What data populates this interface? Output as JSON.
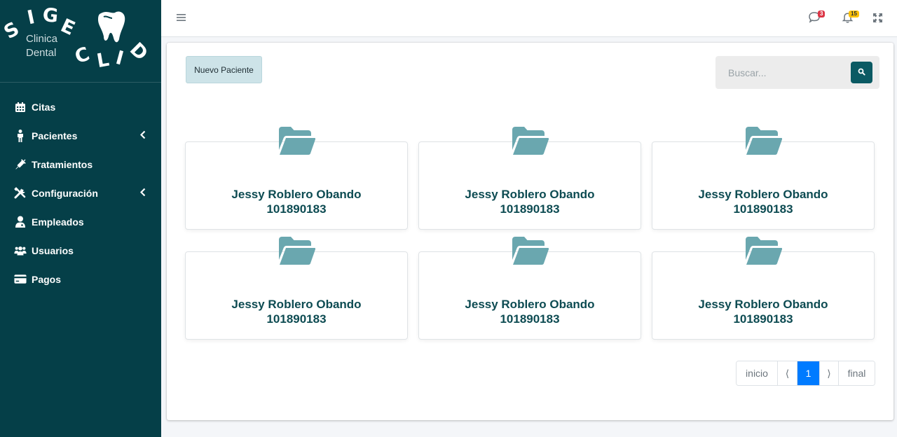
{
  "brand": {
    "letters": [
      "S",
      "I",
      "G",
      "E",
      "C",
      "L",
      "I",
      "D"
    ],
    "subtitle_line1": "Clinica",
    "subtitle_line2": "Dental"
  },
  "sidebar": {
    "items": [
      {
        "label": "Citas",
        "icon": "calendar-icon",
        "has_submenu": false
      },
      {
        "label": "Pacientes",
        "icon": "person-icon",
        "has_submenu": true
      },
      {
        "label": "Tratamientos",
        "icon": "syringe-icon",
        "has_submenu": false
      },
      {
        "label": "Configuración",
        "icon": "tools-icon",
        "has_submenu": true
      },
      {
        "label": "Empleados",
        "icon": "user-doctor-icon",
        "has_submenu": false
      },
      {
        "label": "Usuarios",
        "icon": "users-icon",
        "has_submenu": false
      },
      {
        "label": "Pagos",
        "icon": "credit-card-icon",
        "has_submenu": false
      }
    ]
  },
  "topbar": {
    "messages_count": "3",
    "notifications_count": "15"
  },
  "main": {
    "new_patient_label": "Nuevo Paciente",
    "search_placeholder": "Buscar...",
    "patients": [
      {
        "name": "Jessy Roblero Obando",
        "id": "101890183"
      },
      {
        "name": "Jessy Roblero Obando",
        "id": "101890183"
      },
      {
        "name": "Jessy Roblero Obando",
        "id": "101890183"
      },
      {
        "name": "Jessy Roblero Obando",
        "id": "101890183"
      },
      {
        "name": "Jessy Roblero Obando",
        "id": "101890183"
      },
      {
        "name": "Jessy Roblero Obando",
        "id": "101890183"
      }
    ],
    "pagination": {
      "first": "inicio",
      "prev": "⟨",
      "current": "1",
      "next": "⟩",
      "last": "final"
    }
  },
  "colors": {
    "sidebar_bg": "#053f48",
    "accent": "#0b5a63",
    "folder": "#6aa7af",
    "active_page": "#007bff"
  }
}
